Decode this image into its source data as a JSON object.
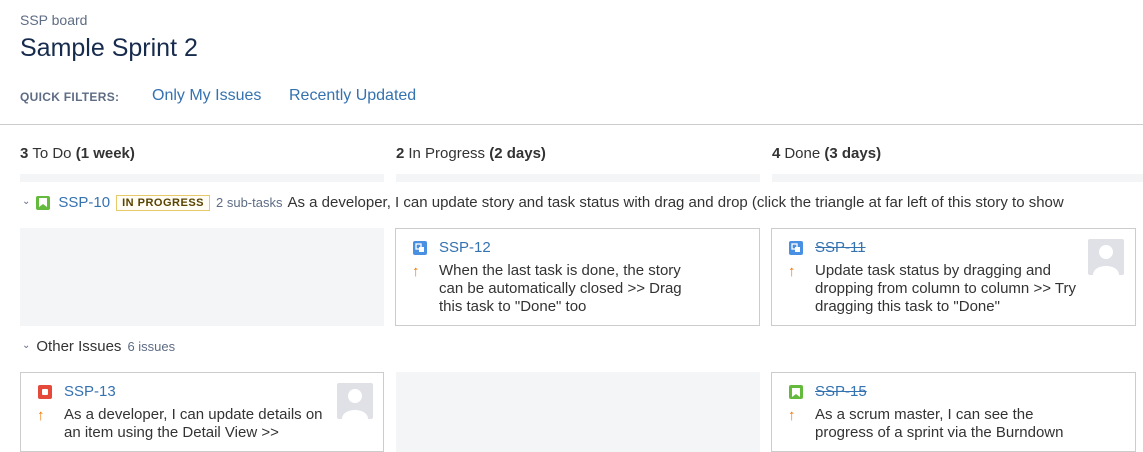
{
  "board": {
    "name": "SSP board",
    "sprint_title": "Sample Sprint 2"
  },
  "quick_filters": {
    "label": "QUICK FILTERS:",
    "items": [
      "Only My Issues",
      "Recently Updated"
    ]
  },
  "columns": [
    {
      "count": "3",
      "name": "To Do",
      "duration": "(1 week)"
    },
    {
      "count": "2",
      "name": "In Progress",
      "duration": "(2 days)"
    },
    {
      "count": "4",
      "name": "Done",
      "duration": "(3 days)"
    }
  ],
  "swimlane_story": {
    "key": "SSP-10",
    "status": "IN PROGRESS",
    "subtasks": "2 sub-tasks",
    "summary": "As a developer, I can update story and task status with drag and drop (click the triangle at far left of this story to show"
  },
  "story_cards": [
    {
      "key": "SSP-12",
      "type": "subtask",
      "done": false,
      "text": "When the last task is done, the story can be automatically closed >> Drag this task to \"Done\" too"
    },
    {
      "key": "SSP-11",
      "type": "subtask",
      "done": true,
      "text": "Update task status by dragging and dropping from column to column >> Try dragging this task to \"Done\""
    }
  ],
  "swimlane_other": {
    "label": "Other Issues",
    "count": "6 issues"
  },
  "other_cards": [
    {
      "key": "SSP-13",
      "type": "bug",
      "done": false,
      "text": "As a developer, I can update details on an item using the Detail View >>"
    },
    {
      "key": "SSP-15",
      "type": "story",
      "done": true,
      "text": "As a scrum master, I can see the progress of a sprint via the Burndown"
    }
  ],
  "colors": {
    "link": "#3572b0",
    "story": "#63ba3c",
    "subtask": "#4a90e2",
    "bug": "#e5493a",
    "priority": "#f07800"
  }
}
